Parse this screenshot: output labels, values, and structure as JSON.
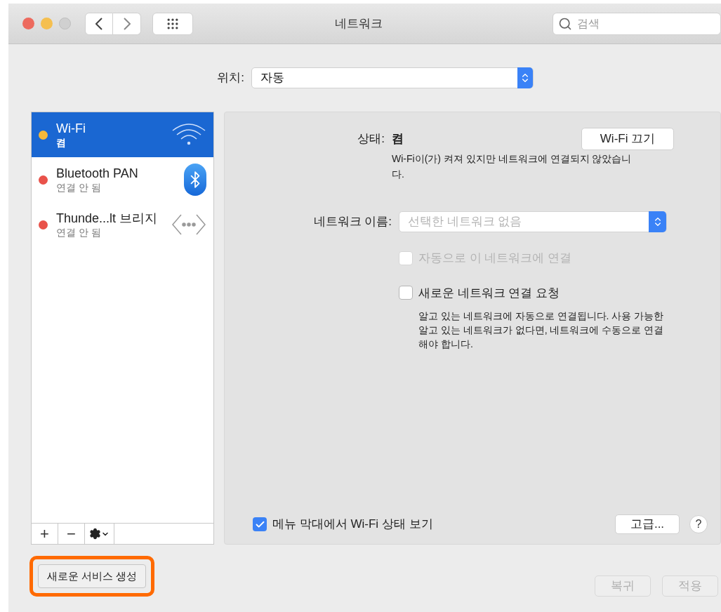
{
  "window": {
    "title": "네트워크"
  },
  "search": {
    "placeholder": "검색"
  },
  "location": {
    "label": "위치:",
    "value": "자동"
  },
  "services": [
    {
      "name": "Wi-Fi",
      "status": "켬",
      "color": "#f5b93a",
      "selected": true,
      "kind": "wifi"
    },
    {
      "name": "Bluetooth PAN",
      "status": "연결 안 됨",
      "color": "#e9524a",
      "selected": false,
      "kind": "bluetooth"
    },
    {
      "name": "Thunde...lt 브리지",
      "status": "연결 안 됨",
      "color": "#e9524a",
      "selected": false,
      "kind": "bridge"
    }
  ],
  "list_toolbar": [
    "+",
    "−"
  ],
  "detail": {
    "status_label": "상태:",
    "status_value": "켬",
    "toggle_button": "Wi-Fi 끄기",
    "status_description": "Wi-Fi이(가) 켜져 있지만 네트워크에 연결되지 않았습니다.",
    "network_name": {
      "label": "네트워크 이름:",
      "placeholder": "선택한 네트워크 없음"
    },
    "options": [
      {
        "label": "자동으로 이 네트워크에 연결",
        "checked": false,
        "disabled": true
      },
      {
        "label": "새로운 네트워크 연결 요청",
        "checked": false,
        "disabled": false
      }
    ],
    "hint": "알고 있는 네트워크에 자동으로 연결됩니다. 사용 가능한 알고 있는 네트워크가 없다면, 네트워크에 수동으로 연결해야 합니다.",
    "show_in_menu_bar": {
      "label": "메뉴 막대에서 Wi-Fi 상태 보기",
      "checked": true
    },
    "advanced_button": "고급...",
    "help_button": "?"
  },
  "create_service_button": {
    "label": "새로운 서비스 생성",
    "highlighted": true
  },
  "footer_buttons": [
    {
      "label": "복귀",
      "disabled": true
    },
    {
      "label": "적용",
      "disabled": true
    }
  ]
}
